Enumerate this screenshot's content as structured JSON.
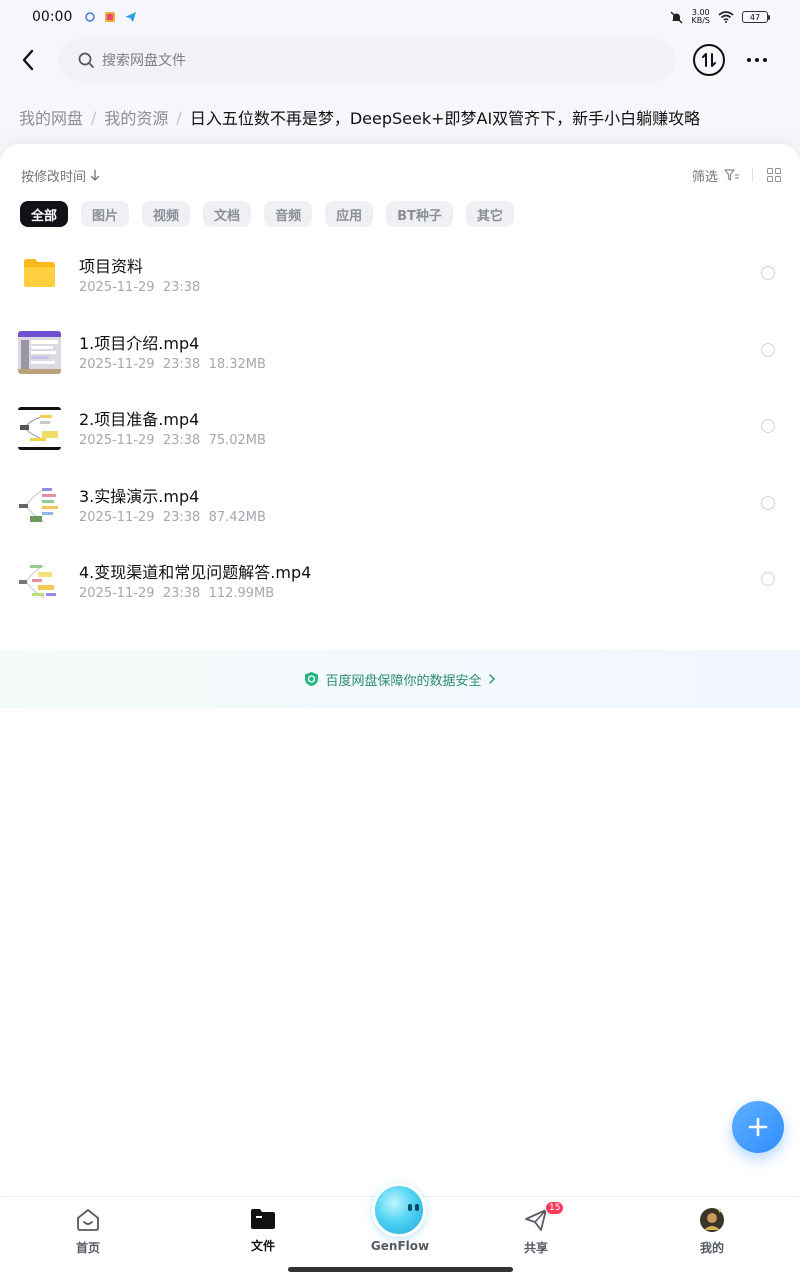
{
  "status_bar": {
    "time": "00:00",
    "net_speed_value": "3.00",
    "net_speed_unit": "KB/S",
    "battery": "47"
  },
  "search": {
    "placeholder": "搜索网盘文件"
  },
  "breadcrumb": {
    "items": [
      "我的网盘",
      "我的资源"
    ],
    "current": "日入五位数不再是梦，DeepSeek+即梦AI双管齐下，新手小白躺赚攻略"
  },
  "toolbar": {
    "sort_label": "按修改时间",
    "filter_label": "筛选"
  },
  "chips": [
    "全部",
    "图片",
    "视频",
    "文档",
    "音频",
    "应用",
    "BT种子",
    "其它"
  ],
  "files": [
    {
      "name": "项目资料",
      "date": "2025-11-29",
      "time": "23:38",
      "size": "",
      "type": "folder"
    },
    {
      "name": "1.项目介绍.mp4",
      "date": "2025-11-29",
      "time": "23:38",
      "size": "18.32MB",
      "type": "video"
    },
    {
      "name": "2.项目准备.mp4",
      "date": "2025-11-29",
      "time": "23:38",
      "size": "75.02MB",
      "type": "video"
    },
    {
      "name": "3.实操演示.mp4",
      "date": "2025-11-29",
      "time": "23:38",
      "size": "87.42MB",
      "type": "video"
    },
    {
      "name": "4.变现渠道和常见问题解答.mp4",
      "date": "2025-11-29",
      "time": "23:38",
      "size": "112.99MB",
      "type": "video"
    }
  ],
  "security_banner": {
    "text": "百度网盘保障你的数据安全"
  },
  "tab_bar": {
    "home": "首页",
    "files": "文件",
    "genflow": "GenFlow",
    "share": "共享",
    "share_badge": "15",
    "mine": "我的"
  },
  "colors": {
    "accent": "#2f8dff",
    "chip_active": "#101218",
    "badge": "#ff3b5c",
    "security": "#2c8d6f"
  }
}
